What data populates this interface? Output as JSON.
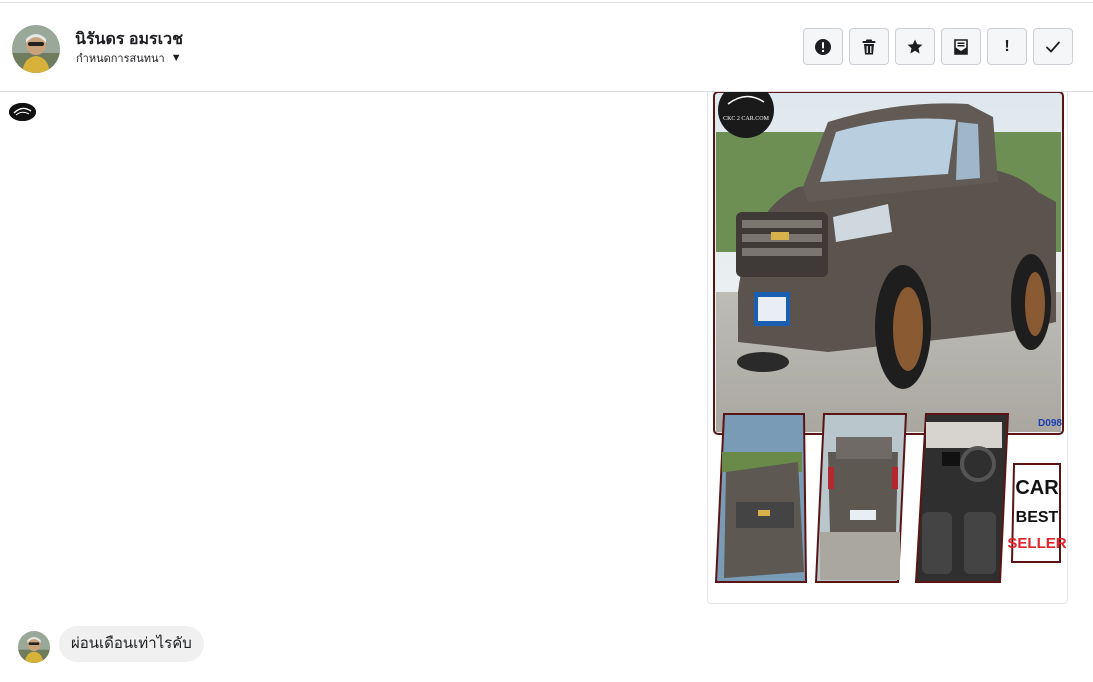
{
  "header": {
    "contact_name": "นิรันดร อมรเวช",
    "conversation_settings_label": "กำหนดการสนทนา",
    "actions": [
      {
        "name": "report-button",
        "icon": "alert-circle-icon"
      },
      {
        "name": "delete-button",
        "icon": "trash-icon"
      },
      {
        "name": "star-button",
        "icon": "star-icon"
      },
      {
        "name": "mark-unread-button",
        "icon": "envelope-icon"
      },
      {
        "name": "follow-up-button",
        "icon": "exclamation-icon",
        "glyph": "!"
      },
      {
        "name": "mark-done-button",
        "icon": "check-icon"
      }
    ]
  },
  "image_attachment": {
    "logo_text": "CKC 2 CAR.COM",
    "corner_code": "D098",
    "badge_lines": [
      "CAR",
      "BEST",
      "SELLER"
    ]
  },
  "messages": [
    {
      "sender": "contact",
      "text": "ผ่อนเดือนเท่าไรคับ"
    }
  ],
  "colors": {
    "border": "#dddfe2",
    "bubble": "#f0f0f0",
    "button_bg": "#f5f6f7",
    "icon": "#1c1e21"
  }
}
